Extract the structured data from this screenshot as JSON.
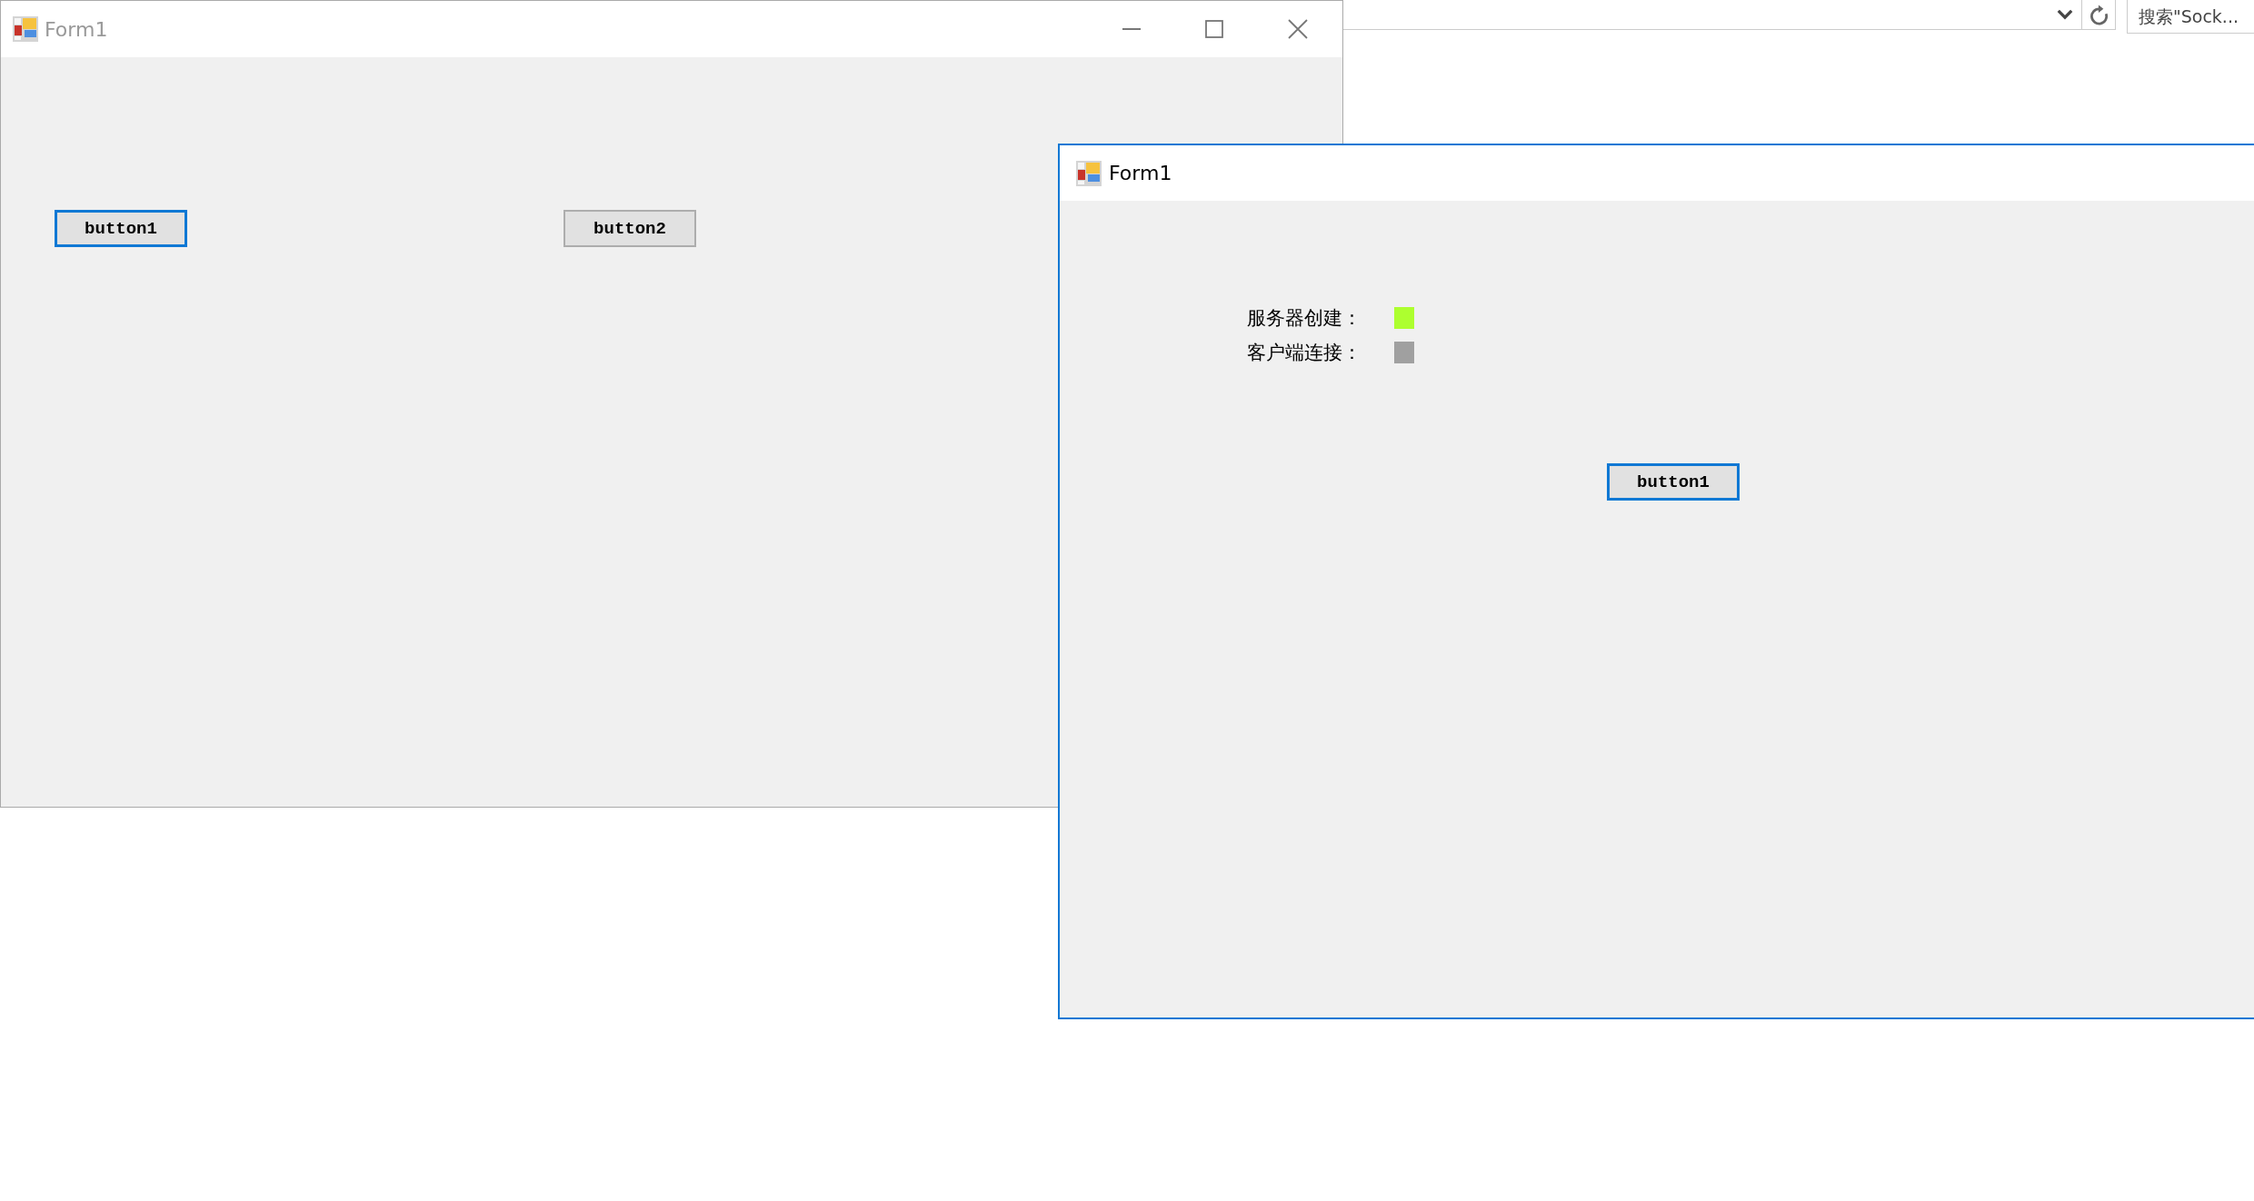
{
  "background_app": {
    "search": {
      "placeholder": "搜索\"Sock..."
    }
  },
  "back_window": {
    "title": "Form1",
    "active": false,
    "caption_buttons": true,
    "buttons": [
      {
        "label": "button1",
        "focused": true
      },
      {
        "label": "button2",
        "focused": false
      }
    ]
  },
  "front_window": {
    "title": "Form1",
    "active": true,
    "status_rows": [
      {
        "label": "服务器创建：",
        "color": "#adff2f"
      },
      {
        "label": "客户端连接：",
        "color": "#a0a0a0"
      }
    ],
    "buttons": [
      {
        "label": "button1",
        "focused": true
      }
    ]
  }
}
